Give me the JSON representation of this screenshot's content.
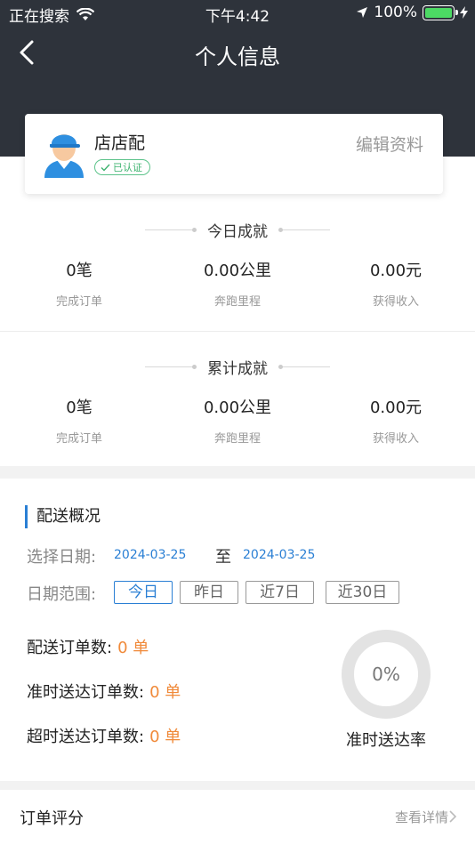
{
  "statusbar": {
    "carrier": "正在搜索",
    "time": "下午4:42",
    "battery": "100%"
  },
  "nav": {
    "title": "个人信息"
  },
  "profile": {
    "name": "店店配",
    "verified": "已认证",
    "edit": "编辑资料"
  },
  "today": {
    "title": "今日成就",
    "stats": [
      {
        "value": "0笔",
        "label": "完成订单"
      },
      {
        "value": "0.00公里",
        "label": "奔跑里程"
      },
      {
        "value": "0.00元",
        "label": "获得收入"
      }
    ]
  },
  "total": {
    "title": "累计成就",
    "stats": [
      {
        "value": "0笔",
        "label": "完成订单"
      },
      {
        "value": "0.00公里",
        "label": "奔跑里程"
      },
      {
        "value": "0.00元",
        "label": "获得收入"
      }
    ]
  },
  "delivery": {
    "title": "配送概况",
    "date_label": "选择日期:",
    "date_from": "2024-03-25",
    "date_sep": "至",
    "date_to": "2024-03-25",
    "range_label": "日期范围:",
    "ranges": [
      "今日",
      "昨日",
      "近7日",
      "近30日"
    ],
    "orders_label": "配送订单数:",
    "orders_value": "0 单",
    "ontime_label": "准时送达订单数:",
    "ontime_value": "0 单",
    "late_label": "超时送达订单数:",
    "late_value": "0 单",
    "rate_value": "0%",
    "rate_label": "准时送达率"
  },
  "rating": {
    "title": "订单评分",
    "more": "查看详情"
  },
  "colors": {
    "header": "#2e333b",
    "accent": "#2a7fd4",
    "orange": "#f08a3a",
    "verified": "#3db36f"
  }
}
